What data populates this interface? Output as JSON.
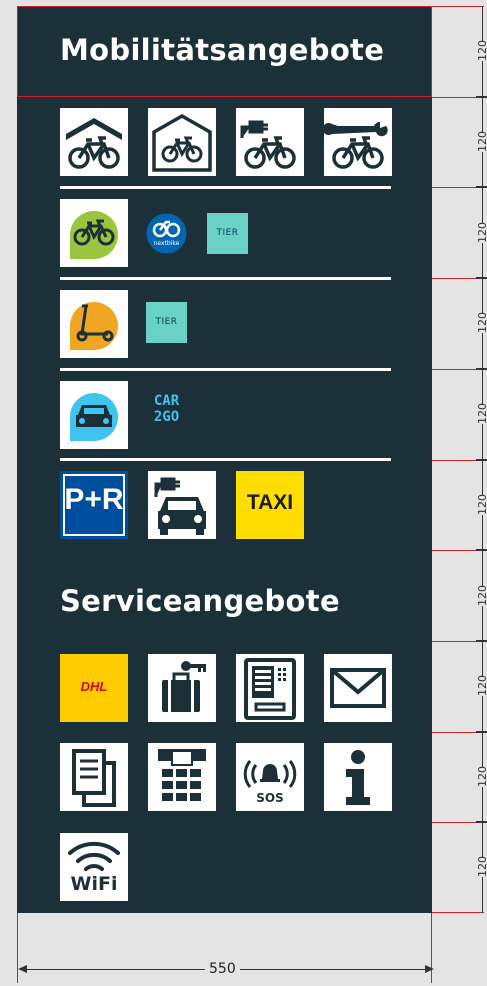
{
  "mobility": {
    "title": "Mobilitätsangebote",
    "bike_icons": [
      "bike-shelter-icon",
      "bike-garage-icon",
      "e-bike-charging-icon",
      "bike-repair-icon"
    ],
    "bikesharing": {
      "icon": "bike-sharing-icon",
      "providers": [
        "nextbike",
        "TIER"
      ]
    },
    "scooter": {
      "icon": "e-scooter-icon",
      "providers": [
        "TIER"
      ]
    },
    "carsharing": {
      "icon": "car-sharing-icon",
      "providers": [
        "CAR",
        "2GO"
      ]
    },
    "parking": {
      "pr_label": "P+R",
      "charging_icon": "ev-charging-icon",
      "taxi_label": "TAXI"
    }
  },
  "service": {
    "title": "Serviceangebote",
    "row1": {
      "dhl_label": "DHL",
      "icons": [
        "dhl-icon",
        "luggage-locker-icon",
        "ticket-machine-icon",
        "mail-icon"
      ]
    },
    "row2": {
      "sos_label": "SOS",
      "icons": [
        "tickets-icon",
        "parcel-station-icon",
        "emergency-call-icon",
        "info-icon"
      ]
    },
    "wifi_label": "WiFi"
  },
  "dimensions": {
    "width": "550",
    "row_height": "120"
  },
  "colors": {
    "panel": "#1c3039",
    "bikeshare_green": "#9bc53d",
    "scooter_orange": "#f0a623",
    "car_blue": "#3fc4f0",
    "tier_teal": "#69d2c4",
    "nextbike_blue": "#0066b3",
    "pr_blue": "#004f9f",
    "taxi_yellow": "#ffdd00",
    "dhl_yellow": "#ffcc00",
    "dhl_red": "#d40511"
  }
}
